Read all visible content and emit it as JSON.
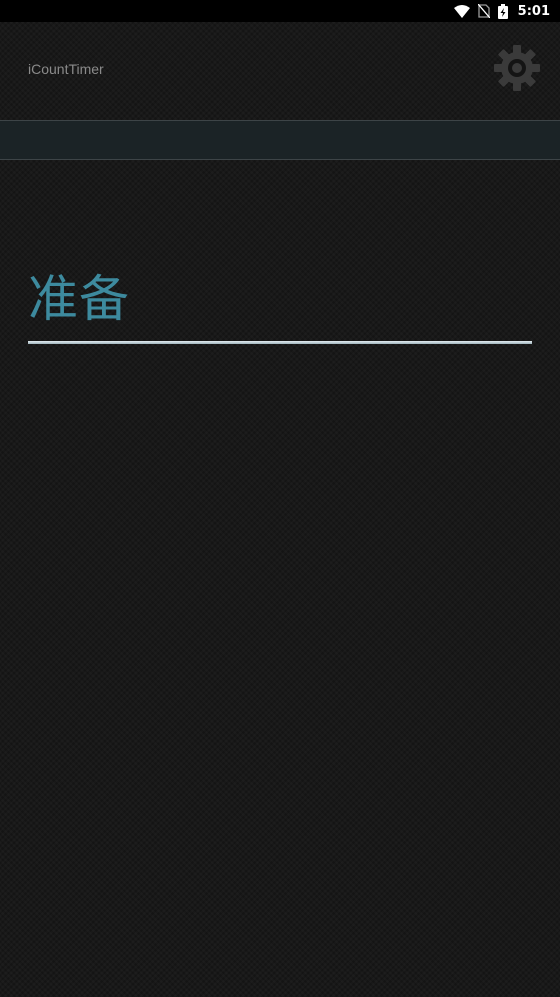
{
  "status_bar": {
    "time": "5:01",
    "icons": [
      "wifi-icon",
      "no-sim-icon",
      "battery-charging-icon"
    ]
  },
  "app": {
    "title": "iCountTimer",
    "settings_icon": "gear-icon"
  },
  "main": {
    "label": "准备"
  },
  "colors": {
    "background": "#141414",
    "accent_text": "#3d8a9e",
    "title_text": "#8a8a8a",
    "tab_strip": "#1b2326"
  }
}
